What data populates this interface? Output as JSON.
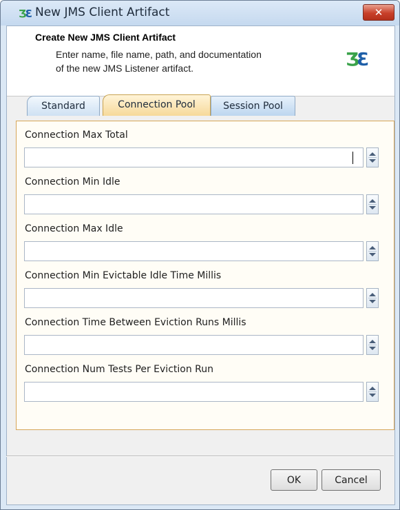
{
  "window": {
    "title": "New JMS Client Artifact",
    "close_label": "✕",
    "title_icon": "jms-client-icon"
  },
  "header": {
    "title": "Create New JMS Client Artifact",
    "description_line1": "Enter name, file name, path, and documentation",
    "description_line2": "of the new JMS Listener artifact.",
    "logo_icon": "jms-client-logo-icon"
  },
  "tabs": [
    {
      "label": "Standard",
      "selected": false
    },
    {
      "label": "Connection Pool",
      "selected": true
    },
    {
      "label": "Session Pool",
      "selected": false
    }
  ],
  "fields": [
    {
      "label": "Connection Max Total",
      "value": ""
    },
    {
      "label": "Connection Min Idle",
      "value": ""
    },
    {
      "label": "Connection Max Idle",
      "value": ""
    },
    {
      "label": "Connection Min Evictable Idle Time Millis",
      "value": ""
    },
    {
      "label": "Connection Time Between Eviction Runs Millis",
      "value": ""
    },
    {
      "label": "Connection Num Tests Per Eviction Run",
      "value": ""
    }
  ],
  "buttons": {
    "ok_label": "OK",
    "cancel_label": "Cancel"
  },
  "colors": {
    "close_red": "#c8402a",
    "selected_tab": "#f6d99a",
    "panel_border": "#d6a557",
    "logo_green": "#3aa24a",
    "logo_blue": "#1f5fa8"
  }
}
